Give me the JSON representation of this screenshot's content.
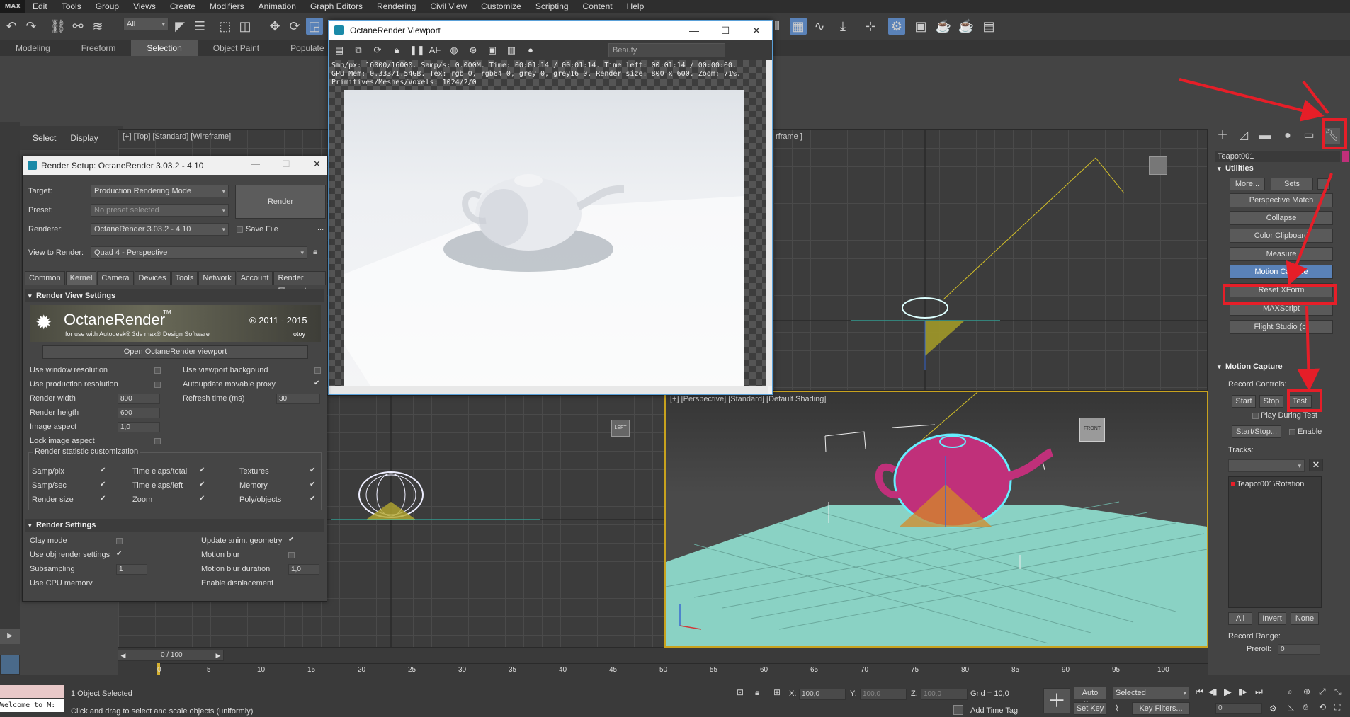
{
  "app": {
    "logo": "MAX"
  },
  "menu": [
    "Edit",
    "Tools",
    "Group",
    "Views",
    "Create",
    "Modifiers",
    "Animation",
    "Graph Editors",
    "Rendering",
    "Civil View",
    "Customize",
    "Scripting",
    "Content",
    "Help"
  ],
  "toolbar": {
    "filter": "All"
  },
  "ribbon_tabs": [
    {
      "label": "Modeling"
    },
    {
      "label": "Freeform"
    },
    {
      "label": "Selection",
      "active": true
    },
    {
      "label": "Object Paint"
    },
    {
      "label": "Populate"
    }
  ],
  "scene_explorer": {
    "select": "Select",
    "display": "Display"
  },
  "viewports": {
    "top_label": "[+] [Top] [Standard] [Wireframe]",
    "front_label": "rframe ]",
    "perspective_label": "[+] [Perspective] [Standard] [Default Shading]",
    "left_cube": "LEFT",
    "front_cube": "FRONT"
  },
  "octane_window": {
    "title": "OctaneRender Viewport",
    "channel": "Beauty",
    "stats": [
      "Smp/px: 16000/16000.   Samp/s: 0.000M.   Time: 00:01:14 / 00:01:14.   Time left: 00:01:14 / 00:00:00.",
      "GPU Mem: 0.333/1.54GB.   Tex: rgb 0, rgb64 0, grey 0, grey16 0.   Render size: 800 x 600.   Zoom: 71%.",
      "Primitives/Meshes/Voxels: 1024/2/0"
    ]
  },
  "render_setup": {
    "title": "Render Setup: OctaneRender 3.03.2 - 4.10",
    "target_label": "Target:",
    "target_value": "Production Rendering Mode",
    "preset_label": "Preset:",
    "preset_value": "No preset selected",
    "renderer_label": "Renderer:",
    "renderer_value": "OctaneRender 3.03.2 - 4.10",
    "save_file": "Save File",
    "view_label": "View to Render:",
    "view_value": "Quad 4 - Perspective",
    "render_button": "Render",
    "more": "...",
    "tabs": [
      "Common",
      "Kernel",
      "Camera",
      "Devices",
      "Tools",
      "Network",
      "Account",
      "Render Elements"
    ],
    "active_tab": "Kernel",
    "section_view": "Render View Settings",
    "banner_title": "OctaneRender",
    "banner_tm": "TM",
    "banner_sub": "for use with Autodesk® 3ds max® Design Software",
    "banner_years": "® 2011 - 2015",
    "banner_brand": "otoy",
    "open_viewport": "Open OctaneRender viewport",
    "options_left": [
      "Use window resolution",
      "Use production resolution",
      "Render width",
      "Render heigth",
      "Image aspect",
      "Lock image aspect"
    ],
    "options_right": [
      "Use viewport backgound",
      "Autoupdate movable proxy",
      "Refresh time (ms)"
    ],
    "render_width": "800",
    "render_height": "600",
    "image_aspect": "1,0",
    "refresh_time": "30",
    "stat_group": "Render statistic customization",
    "stats": [
      "Samp/pix",
      "Time elaps/total",
      "Textures",
      "Samp/sec",
      "Time elaps/left",
      "Memory",
      "Render size",
      "Zoom",
      "Poly/objects"
    ],
    "section_render": "Render Settings",
    "render_opts_left": [
      "Clay mode",
      "Use obj render settings",
      "Subsampling",
      "Use CPU memory"
    ],
    "render_opts_right": [
      "Update anim. geometry",
      "Motion blur",
      "Motion blur duration",
      "Enable displacement"
    ],
    "subsampling": "1",
    "mb_duration": "1,0"
  },
  "command_panel": {
    "object_name": "Teapot001",
    "section_utilities": "Utilities",
    "more": "More...",
    "sets": "Sets",
    "utilities": [
      "Perspective Match",
      "Collapse",
      "Color Clipboard",
      "Measure",
      "Motion Capture",
      "Reset XForm",
      "MAXScript",
      "Flight Studio (c)"
    ],
    "active_utility": "Motion Capture",
    "section_mocap": "Motion Capture",
    "record_controls": "Record Controls:",
    "start": "Start",
    "stop": "Stop",
    "test": "Test",
    "play_during_test": "Play During Test",
    "start_stop": "Start/Stop...",
    "enable": "Enable",
    "tracks_label": "Tracks:",
    "track_item": "Teapot001\\Rotation",
    "all": "All",
    "invert": "Invert",
    "none": "None",
    "record_range": "Record Range:",
    "preroll_label": "Preroll:",
    "preroll_value": "0"
  },
  "timeline": {
    "frame": "0 / 100",
    "ticks": [
      "0",
      "5",
      "10",
      "15",
      "20",
      "25",
      "30",
      "35",
      "40",
      "45",
      "50",
      "55",
      "60",
      "65",
      "70",
      "75",
      "80",
      "85",
      "90",
      "95",
      "100"
    ]
  },
  "status": {
    "listener": "Welcome to M:",
    "selected": "1 Object Selected",
    "prompt": "Click and drag to select and scale objects (uniformly)",
    "x_label": "X:",
    "x_value": "100,0",
    "y_label": "Y:",
    "y_value": "100,0",
    "z_label": "Z:",
    "z_value": "100,0",
    "grid": "Grid = 10,0",
    "add_time_tag": "Add Time Tag",
    "auto_key": "Auto Key",
    "set_key": "Set Key",
    "key_mode": "Selected",
    "key_filters": "Key Filters...",
    "frame_field": "0"
  },
  "colors": {
    "accent": "#5a82b8",
    "annotation": "#e61e28",
    "teapot": "#c0307a",
    "ground": "#8ad2c4"
  }
}
